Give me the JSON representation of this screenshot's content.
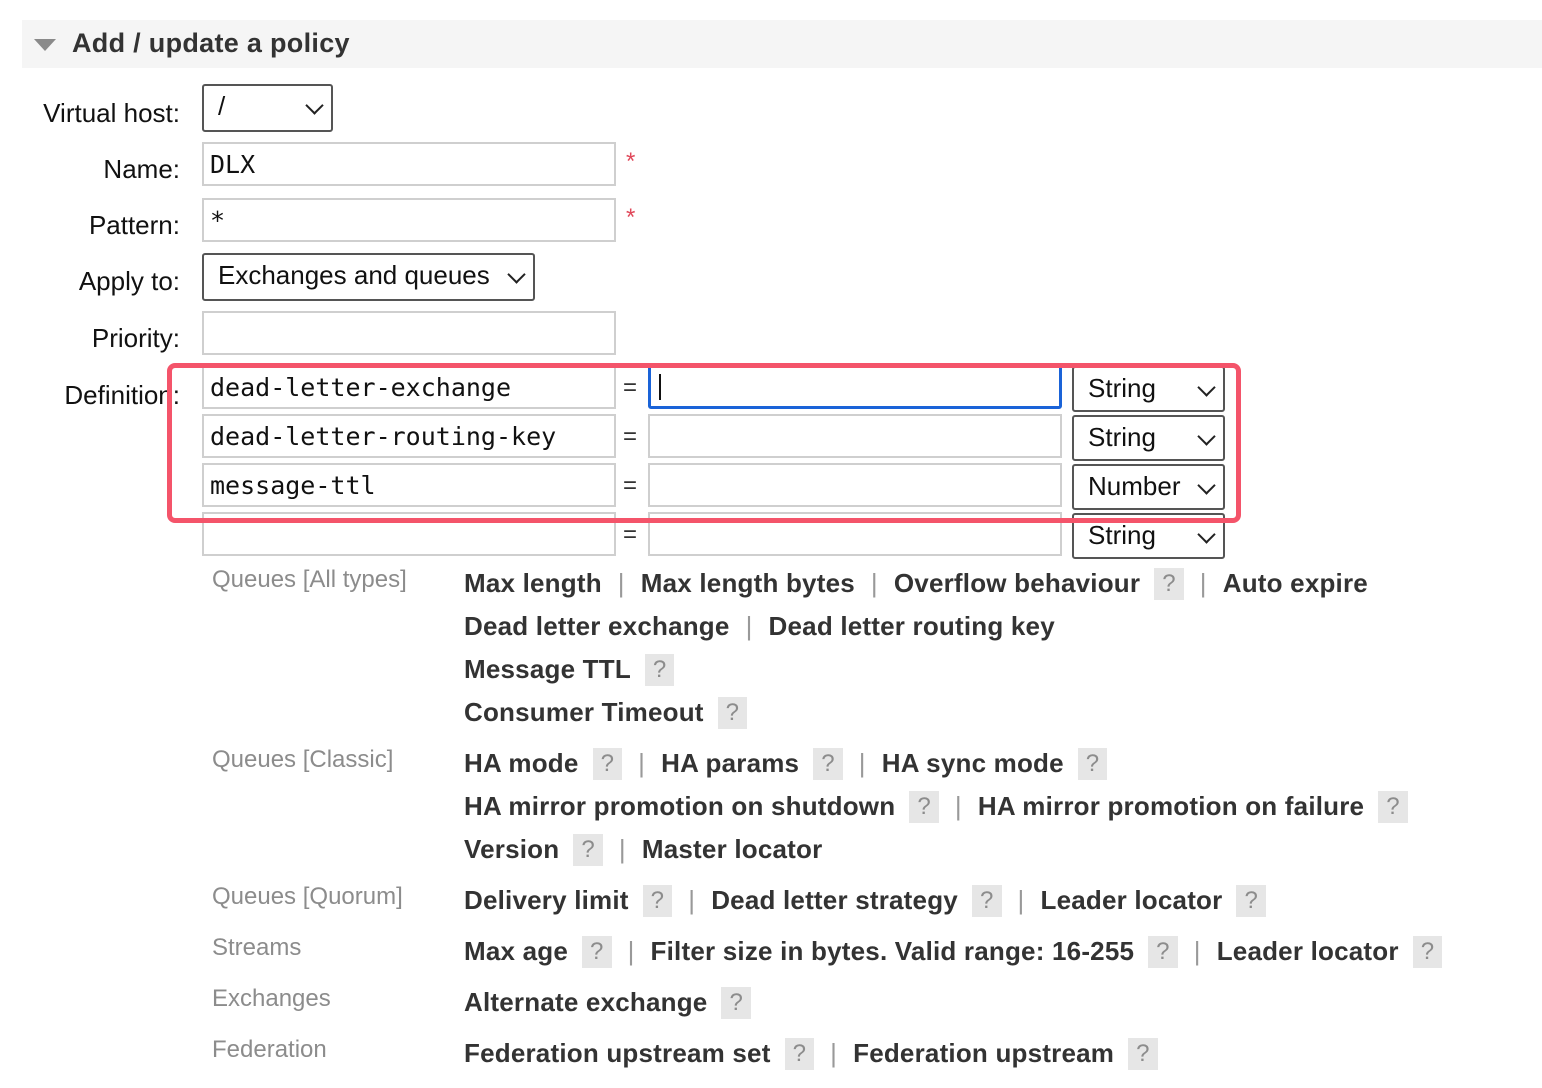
{
  "section": {
    "title": "Add / update a policy"
  },
  "form": {
    "vhost": {
      "label": "Virtual host:",
      "value": "/"
    },
    "name": {
      "label": "Name:",
      "value": "DLX",
      "required": "*"
    },
    "pattern": {
      "label": "Pattern:",
      "value": "*",
      "required": "*"
    },
    "apply_to": {
      "label": "Apply to:",
      "value": "Exchanges and queues"
    },
    "priority": {
      "label": "Priority:",
      "value": ""
    },
    "definition": {
      "label": "Definition:",
      "eq": "=",
      "rows": [
        {
          "key": "dead-letter-exchange",
          "value": "",
          "type": "String"
        },
        {
          "key": "dead-letter-routing-key",
          "value": "",
          "type": "String"
        },
        {
          "key": "message-ttl",
          "value": "",
          "type": "Number"
        },
        {
          "key": "",
          "value": "",
          "type": "String"
        }
      ]
    }
  },
  "help": {
    "q": "?",
    "sep": "|"
  },
  "groups": {
    "queues_all": {
      "label": "Queues [All types]",
      "lines": [
        [
          "Max length",
          "Max length bytes",
          "Overflow behaviour",
          "Auto expire"
        ],
        [
          "Dead letter exchange",
          "Dead letter routing key"
        ],
        [
          "Message TTL"
        ],
        [
          "Consumer Timeout"
        ]
      ]
    },
    "queues_classic": {
      "label": "Queues [Classic]",
      "lines": [
        [
          "HA mode",
          "HA params",
          "HA sync mode"
        ],
        [
          "HA mirror promotion on shutdown",
          "HA mirror promotion on failure"
        ],
        [
          "Version",
          "Master locator"
        ]
      ]
    },
    "queues_quorum": {
      "label": "Queues [Quorum]",
      "items": [
        "Delivery limit",
        "Dead letter strategy",
        "Leader locator"
      ]
    },
    "streams": {
      "label": "Streams",
      "items": [
        "Max age",
        "Filter size in bytes. Valid range: 16-255",
        "Leader locator"
      ]
    },
    "exchanges": {
      "label": "Exchanges",
      "items": [
        "Alternate exchange"
      ]
    },
    "federation": {
      "label": "Federation",
      "items": [
        "Federation upstream set",
        "Federation upstream"
      ]
    }
  },
  "colors": {
    "highlight": "#f4546a",
    "focus": "#1a63d8",
    "required": "#e0485a"
  }
}
